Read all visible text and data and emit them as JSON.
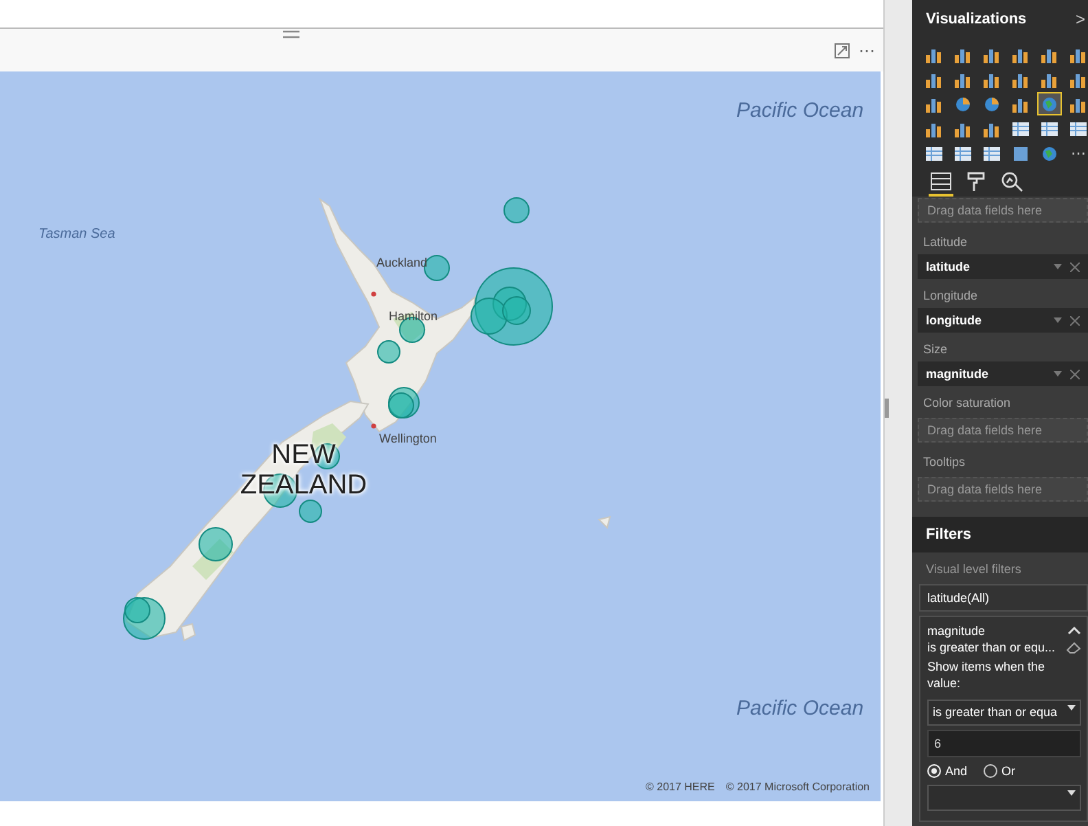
{
  "visual": {
    "menu": "⋯"
  },
  "map": {
    "labels": [
      {
        "kind": "ocean",
        "text": "Pacific Ocean"
      },
      {
        "kind": "ocean",
        "text": "Pacific Ocean"
      },
      {
        "kind": "sea",
        "text": "Tasman Sea"
      },
      {
        "kind": "city",
        "text": "Auckland"
      },
      {
        "kind": "city",
        "text": "Hamilton"
      },
      {
        "kind": "city",
        "text": "Wellington"
      },
      {
        "kind": "country",
        "text": "NEW ZEALAND"
      }
    ],
    "credits": [
      "© 2017 HERE",
      "© 2017 Microsoft Corporation"
    ]
  },
  "visualizations": {
    "title": "Visualizations",
    "collapse": ">",
    "types": [
      {
        "selected": false
      },
      {
        "selected": false
      },
      {
        "selected": false
      },
      {
        "selected": false
      },
      {
        "selected": false
      },
      {
        "selected": false
      },
      {
        "selected": false
      },
      {
        "selected": false
      },
      {
        "selected": false
      },
      {
        "selected": false
      },
      {
        "selected": false
      },
      {
        "selected": false
      },
      {
        "selected": false
      },
      {
        "selected": false
      },
      {
        "selected": false
      },
      {
        "selected": false
      },
      {
        "selected": true
      },
      {
        "selected": false
      },
      {
        "selected": false
      },
      {
        "selected": false
      },
      {
        "selected": false
      },
      {
        "selected": false
      },
      {
        "selected": false
      },
      {
        "selected": false
      },
      {
        "selected": false
      },
      {
        "selected": false
      },
      {
        "selected": false
      },
      {
        "selected": false
      },
      {
        "selected": false
      }
    ],
    "more": "⋯",
    "tabs": [
      {
        "selected": true
      },
      {
        "selected": false
      },
      {
        "selected": false
      }
    ],
    "top_hint": "Drag data fields here",
    "wells": [
      {
        "label": "Latitude",
        "field": "latitude"
      },
      {
        "label": "Longitude",
        "field": "longitude"
      },
      {
        "label": "Size",
        "field": "magnitude"
      },
      {
        "label": "Color saturation",
        "placeholder": "Drag data fields here"
      },
      {
        "label": "Tooltips",
        "placeholder": "Drag data fields here"
      }
    ]
  },
  "filters": {
    "title": "Filters",
    "section": "Visual level filters",
    "items": [
      {
        "name": "latitude(All)",
        "expanded": false
      },
      {
        "name": "magnitude",
        "expanded": true,
        "summary": "is greater than or equ...",
        "prompt": "Show items when the value:",
        "operator": "is greater than or equa",
        "value": "6",
        "logic": [
          {
            "label": "And",
            "selected": true
          },
          {
            "label": "Or",
            "selected": false
          }
        ]
      }
    ]
  }
}
